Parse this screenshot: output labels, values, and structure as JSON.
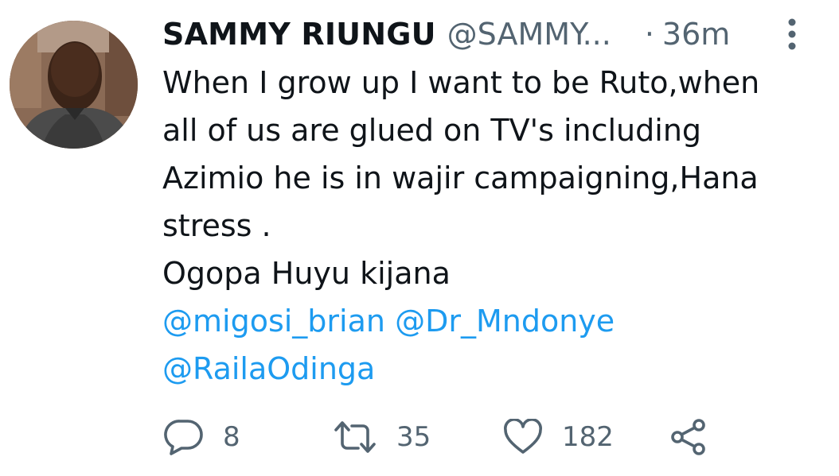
{
  "tweet": {
    "display_name": "SAMMY RIUNGU",
    "handle": "@SAMMY...",
    "separator": "·",
    "time": "36m",
    "text_lines": [
      "When I grow up I want to be Ruto,when",
      "all of us are glued on TV's including",
      "Azimio he is in wajir campaigning,Hana",
      "stress .",
      "Ogopa Huyu kijana"
    ],
    "mentions_lines": [
      [
        "@migosi_brian",
        "@Dr_Mndonye"
      ],
      [
        "@RailaOdinga"
      ]
    ]
  },
  "actions": {
    "reply_count": "8",
    "retweet_count": "35",
    "like_count": "182"
  },
  "icons": {
    "reply": "reply-icon",
    "retweet": "retweet-icon",
    "like": "heart-icon",
    "share": "share-icon",
    "more": "more-vertical-icon"
  },
  "colors": {
    "text": "#0f1419",
    "secondary": "#536471",
    "link": "#1d9bf0"
  }
}
